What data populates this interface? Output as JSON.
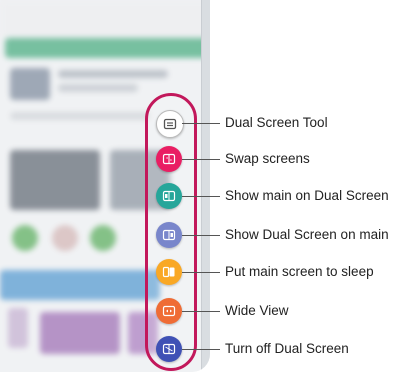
{
  "menu": {
    "items": [
      {
        "label": "Dual Screen Tool",
        "icon": "dual-screen-tool-icon",
        "color": "#ffffff"
      },
      {
        "label": "Swap screens",
        "icon": "swap-screens-icon",
        "color": "#e91e63"
      },
      {
        "label": "Show main on Dual Screen",
        "icon": "show-main-on-dual-icon",
        "color": "#26a69a"
      },
      {
        "label": "Show Dual Screen on main",
        "icon": "show-dual-on-main-icon",
        "color": "#7986cb"
      },
      {
        "label": "Put main screen to sleep",
        "icon": "sleep-main-icon",
        "color": "#f9a825"
      },
      {
        "label": "Wide View",
        "icon": "wide-view-icon",
        "color": "#ef6c35"
      },
      {
        "label": "Turn off Dual Screen",
        "icon": "turn-off-dual-icon",
        "color": "#3f51b5"
      }
    ]
  },
  "colors": {
    "pill_border": "#c2185b",
    "leader_line": "#555555"
  }
}
